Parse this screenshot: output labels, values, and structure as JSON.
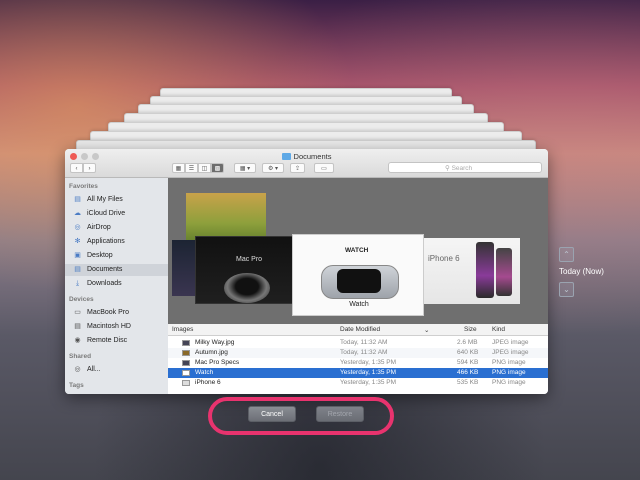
{
  "window": {
    "title": "Documents"
  },
  "search": {
    "placeholder": "Search"
  },
  "sidebar": {
    "favorites_header": "Favorites",
    "favorites": [
      "All My Files",
      "iCloud Drive",
      "AirDrop",
      "Applications",
      "Desktop",
      "Documents",
      "Downloads"
    ],
    "selected": "Documents",
    "devices_header": "Devices",
    "devices": [
      "MacBook Pro",
      "Macintosh HD",
      "Remote Disc"
    ],
    "shared_header": "Shared",
    "shared": [
      "All..."
    ],
    "tags_header": "Tags"
  },
  "preview": {
    "mac_pro_text": "Mac Pro",
    "watch_banner": "WATCH",
    "watch_label": "Watch",
    "iphone_text": "iPhone 6"
  },
  "list": {
    "columns": [
      "Images",
      "Date Modified",
      "Size",
      "Kind"
    ],
    "rows": [
      {
        "name": "Milky Way.jpg",
        "date": "Today, 11:32 AM",
        "size": "2.6 MB",
        "kind": "JPEG image"
      },
      {
        "name": "Autumn.jpg",
        "date": "Today, 11:32 AM",
        "size": "640 KB",
        "kind": "JPEG image"
      },
      {
        "name": "Mac Pro Specs",
        "date": "Yesterday, 1:35 PM",
        "size": "594 KB",
        "kind": "PNG image"
      },
      {
        "name": "Watch",
        "date": "Yesterday, 1:35 PM",
        "size": "466 KB",
        "kind": "PNG image"
      },
      {
        "name": "iPhone 6",
        "date": "Yesterday, 1:35 PM",
        "size": "535 KB",
        "kind": "PNG image"
      }
    ],
    "selected_row": "Watch"
  },
  "time_machine": {
    "current_label": "Today (Now)"
  },
  "actions": {
    "cancel": "Cancel",
    "restore": "Restore"
  },
  "colors": {
    "highlight_ring": "#e8336e",
    "selection": "#2a6fd1"
  }
}
